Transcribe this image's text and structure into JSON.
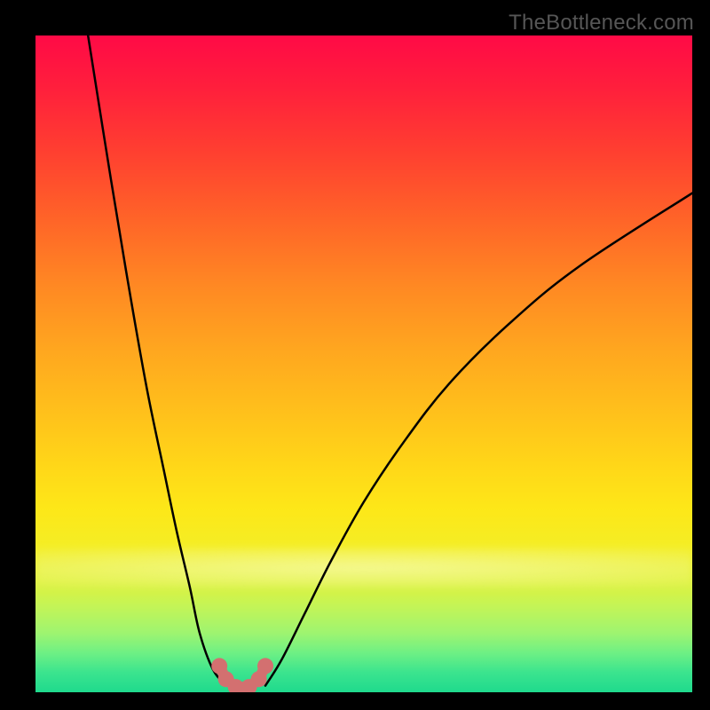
{
  "watermark": "TheBottleneck.com",
  "colors": {
    "background": "#000000",
    "curve_stroke": "#000000",
    "marker_fill": "#d37070",
    "gradient_top": "#ff0a46",
    "gradient_bottom": "#1fda8d"
  },
  "chart_data": {
    "type": "line",
    "title": "",
    "xlabel": "",
    "ylabel": "",
    "xlim": [
      0,
      100
    ],
    "ylim": [
      0,
      100
    ],
    "grid": false,
    "legend": false,
    "notes": "Two curves forming a V over a vertical red-to-green gradient. The lowest point of the V touches the green band; a small cluster of pink markers sits there. Values are estimated from pixels because the chart has no tick labels.",
    "series": [
      {
        "name": "left-branch",
        "x": [
          8.0,
          11.5,
          14.5,
          17.0,
          19.5,
          21.5,
          23.5,
          25.0,
          27.0,
          29.0
        ],
        "y": [
          100.0,
          78.0,
          60.0,
          46.0,
          34.0,
          24.5,
          16.0,
          9.0,
          3.5,
          1.0
        ]
      },
      {
        "name": "right-branch",
        "x": [
          35.0,
          37.5,
          41.0,
          45.0,
          50.0,
          56.0,
          63.0,
          72.0,
          83.0,
          100.0
        ],
        "y": [
          1.0,
          5.0,
          12.0,
          20.0,
          29.0,
          38.0,
          47.0,
          56.0,
          65.0,
          76.0
        ]
      }
    ],
    "markers": {
      "name": "highlighted-minimum",
      "x": [
        28.0,
        29.0,
        30.5,
        32.5,
        34.0,
        35.0
      ],
      "y": [
        4.0,
        2.0,
        0.8,
        0.8,
        2.0,
        4.0
      ]
    }
  }
}
